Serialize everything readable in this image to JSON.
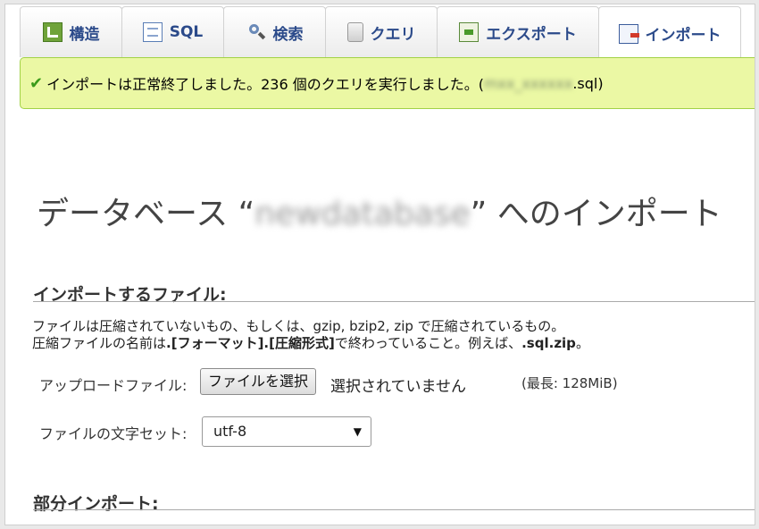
{
  "tabs": [
    {
      "label": "構造",
      "icon": "structure-icon"
    },
    {
      "label": "SQL",
      "icon": "sql-icon"
    },
    {
      "label": "検索",
      "icon": "search-icon"
    },
    {
      "label": "クエリ",
      "icon": "query-icon"
    },
    {
      "label": "エクスポート",
      "icon": "export-icon"
    },
    {
      "label": "インポート",
      "icon": "import-icon",
      "active": true
    }
  ],
  "message": {
    "text_before": "インポートは正常終了しました。236 個のクエリを実行しました。(",
    "blurred_filename": "mxx_xxxxxx",
    "text_after": ".sql)"
  },
  "heading": {
    "prefix": "データベース “",
    "db_name": "newdatabase",
    "suffix": "” へのインポート"
  },
  "file_section": {
    "title": "インポートするファイル:",
    "desc_line1": "ファイルは圧縮されていないもの、もしくは、gzip, bzip2, zip で圧縮されているもの。",
    "desc_line2_pre": "圧縮ファイルの名前は",
    "desc_line2_bold1": ".[フォーマット].[圧縮形式]",
    "desc_line2_mid": "で終わっていること。例えば、",
    "desc_line2_bold2": ".sql.zip",
    "desc_line2_end": "。",
    "upload_label": "アップロードファイル:",
    "choose_button": "ファイルを選択",
    "no_file": "選択されていません",
    "max_size": "(最長: 128MiB)",
    "charset_label": "ファイルの文字セット:",
    "charset_value": "utf-8"
  },
  "partial_section": {
    "title": "部分インポート:"
  }
}
